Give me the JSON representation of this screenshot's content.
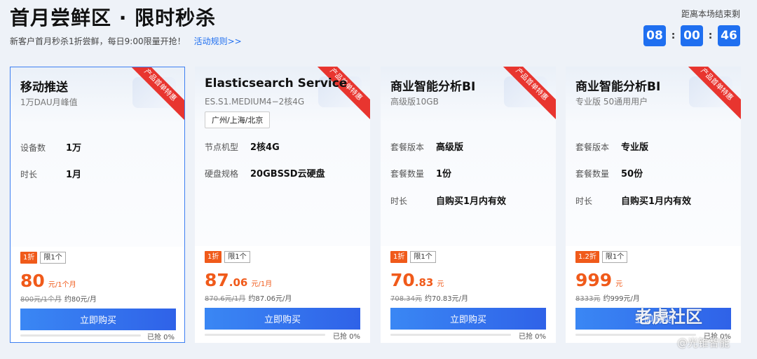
{
  "header": {
    "title": "首月尝鲜区 · 限时秒杀",
    "subtitle": "新客户首月秒杀1折尝鲜，每日9:00限量开抢！",
    "rules_link": "活动规则>>",
    "countdown_label": "距离本场结束剩",
    "countdown": {
      "h": "08",
      "m": "00",
      "s": "46",
      "sep": ":"
    }
  },
  "ribbon_text": "产品首单特惠",
  "buy_label": "立即购买",
  "cards": [
    {
      "title": "移动推送",
      "subtitle": "1万DAU月峰值",
      "tag": "",
      "specs": [
        {
          "k": "设备数",
          "v": "1万"
        },
        {
          "k": "时长",
          "v": "1月"
        }
      ],
      "discount": "1折",
      "limit": "限1个",
      "price_int": "80",
      "price_dec": "",
      "price_unit": "元/1个月",
      "orig_price": "800元/1个月",
      "approx": "约80元/月",
      "sold": "已抢 0%",
      "sold_fraction": 0.0
    },
    {
      "title": "Elasticsearch Service",
      "subtitle": "ES.S1.MEDIUM4−2核4G",
      "tag": "广州/上海/北京",
      "specs": [
        {
          "k": "节点机型",
          "v": "2核4G"
        },
        {
          "k": "硬盘规格",
          "v": "20GBSSD云硬盘"
        }
      ],
      "discount": "1折",
      "limit": "限1个",
      "price_int": "87",
      "price_dec": ".06",
      "price_unit": "元/1月",
      "orig_price": "870.6元/1月",
      "approx": "约87.06元/月",
      "sold": "已抢 0%",
      "sold_fraction": 0.0
    },
    {
      "title": "商业智能分析BI",
      "subtitle": "高级版10GB",
      "tag": "",
      "specs": [
        {
          "k": "套餐版本",
          "v": "高级版"
        },
        {
          "k": "套餐数量",
          "v": "1份"
        },
        {
          "k": "时长",
          "v": "自购买1月内有效"
        }
      ],
      "discount": "1折",
      "limit": "限1个",
      "price_int": "70",
      "price_dec": ".83",
      "price_unit": "元",
      "orig_price": "708.34元",
      "approx": "约70.83元/月",
      "sold": "已抢 0%",
      "sold_fraction": 0.0
    },
    {
      "title": "商业智能分析BI",
      "subtitle": "专业版 50通用用户",
      "tag": "",
      "specs": [
        {
          "k": "套餐版本",
          "v": "专业版"
        },
        {
          "k": "套餐数量",
          "v": "50份"
        },
        {
          "k": "时长",
          "v": "自购买1月内有效"
        }
      ],
      "discount": "1.2折",
      "limit": "限1个",
      "price_int": "999",
      "price_dec": "",
      "price_unit": "元",
      "orig_price": "8333元",
      "approx": "约999元/月",
      "sold": "已抢 0%",
      "sold_fraction": 0.0
    }
  ],
  "watermark": {
    "line1": "老虎社区",
    "line2": "@光锥智能"
  },
  "colors": {
    "accent": "#1f6ff0",
    "price": "#f05a1a",
    "ribbon": "#e8352f"
  }
}
